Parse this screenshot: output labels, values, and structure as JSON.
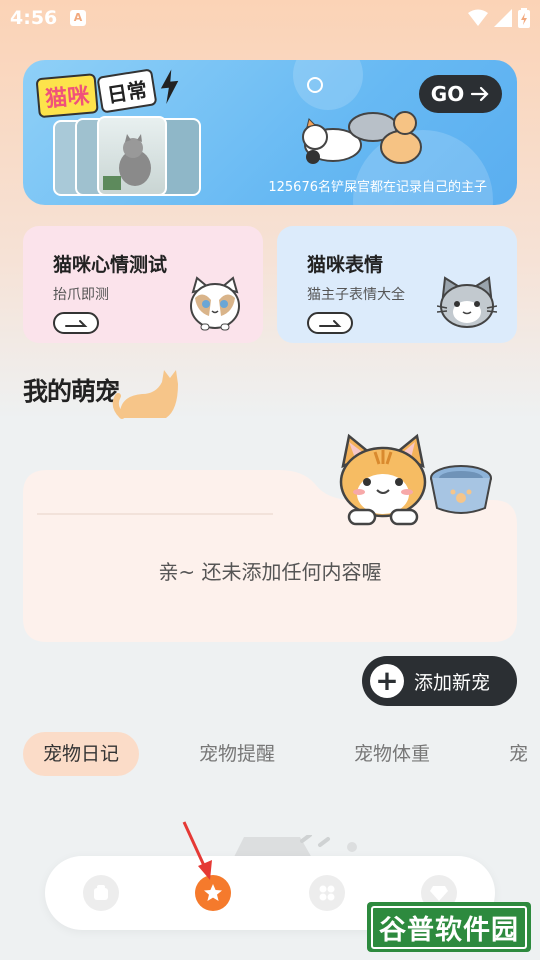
{
  "status": {
    "time": "4:56",
    "notif_glyph": "A"
  },
  "banner": {
    "title_a": "猫咪",
    "title_b": "日常",
    "go_label": "GO",
    "caption": "125676名铲屎官都在记录自己的主子",
    "accent": "#67b9f3"
  },
  "cards": [
    {
      "title": "猫咪心情测试",
      "subtitle": "抬爪即测",
      "bg": "#fbe3eb"
    },
    {
      "title": "猫咪表情",
      "subtitle": "猫主子表情大全",
      "bg": "#dcebfb"
    }
  ],
  "section": {
    "title": "我的萌宠"
  },
  "pet": {
    "empty_text": "亲~ 还未添加任何内容喔"
  },
  "add_button": {
    "label": "添加新宠",
    "icon": "plus-icon"
  },
  "tabs": [
    {
      "label": "宠物日记",
      "active": true
    },
    {
      "label": "宠物提醒",
      "active": false
    },
    {
      "label": "宠物体重",
      "active": false
    },
    {
      "label": "宠",
      "active": false
    }
  ],
  "bottom_nav": [
    {
      "icon": "home-icon",
      "active": false
    },
    {
      "icon": "star-icon",
      "active": true
    },
    {
      "icon": "grid-icon",
      "active": false
    },
    {
      "icon": "diamond-icon",
      "active": false
    }
  ],
  "watermark": {
    "text": "谷普软件园"
  },
  "colors": {
    "primary_dark": "#2b2f33",
    "accent_orange": "#f57a2c",
    "tab_active_bg": "#fbdcc8"
  }
}
